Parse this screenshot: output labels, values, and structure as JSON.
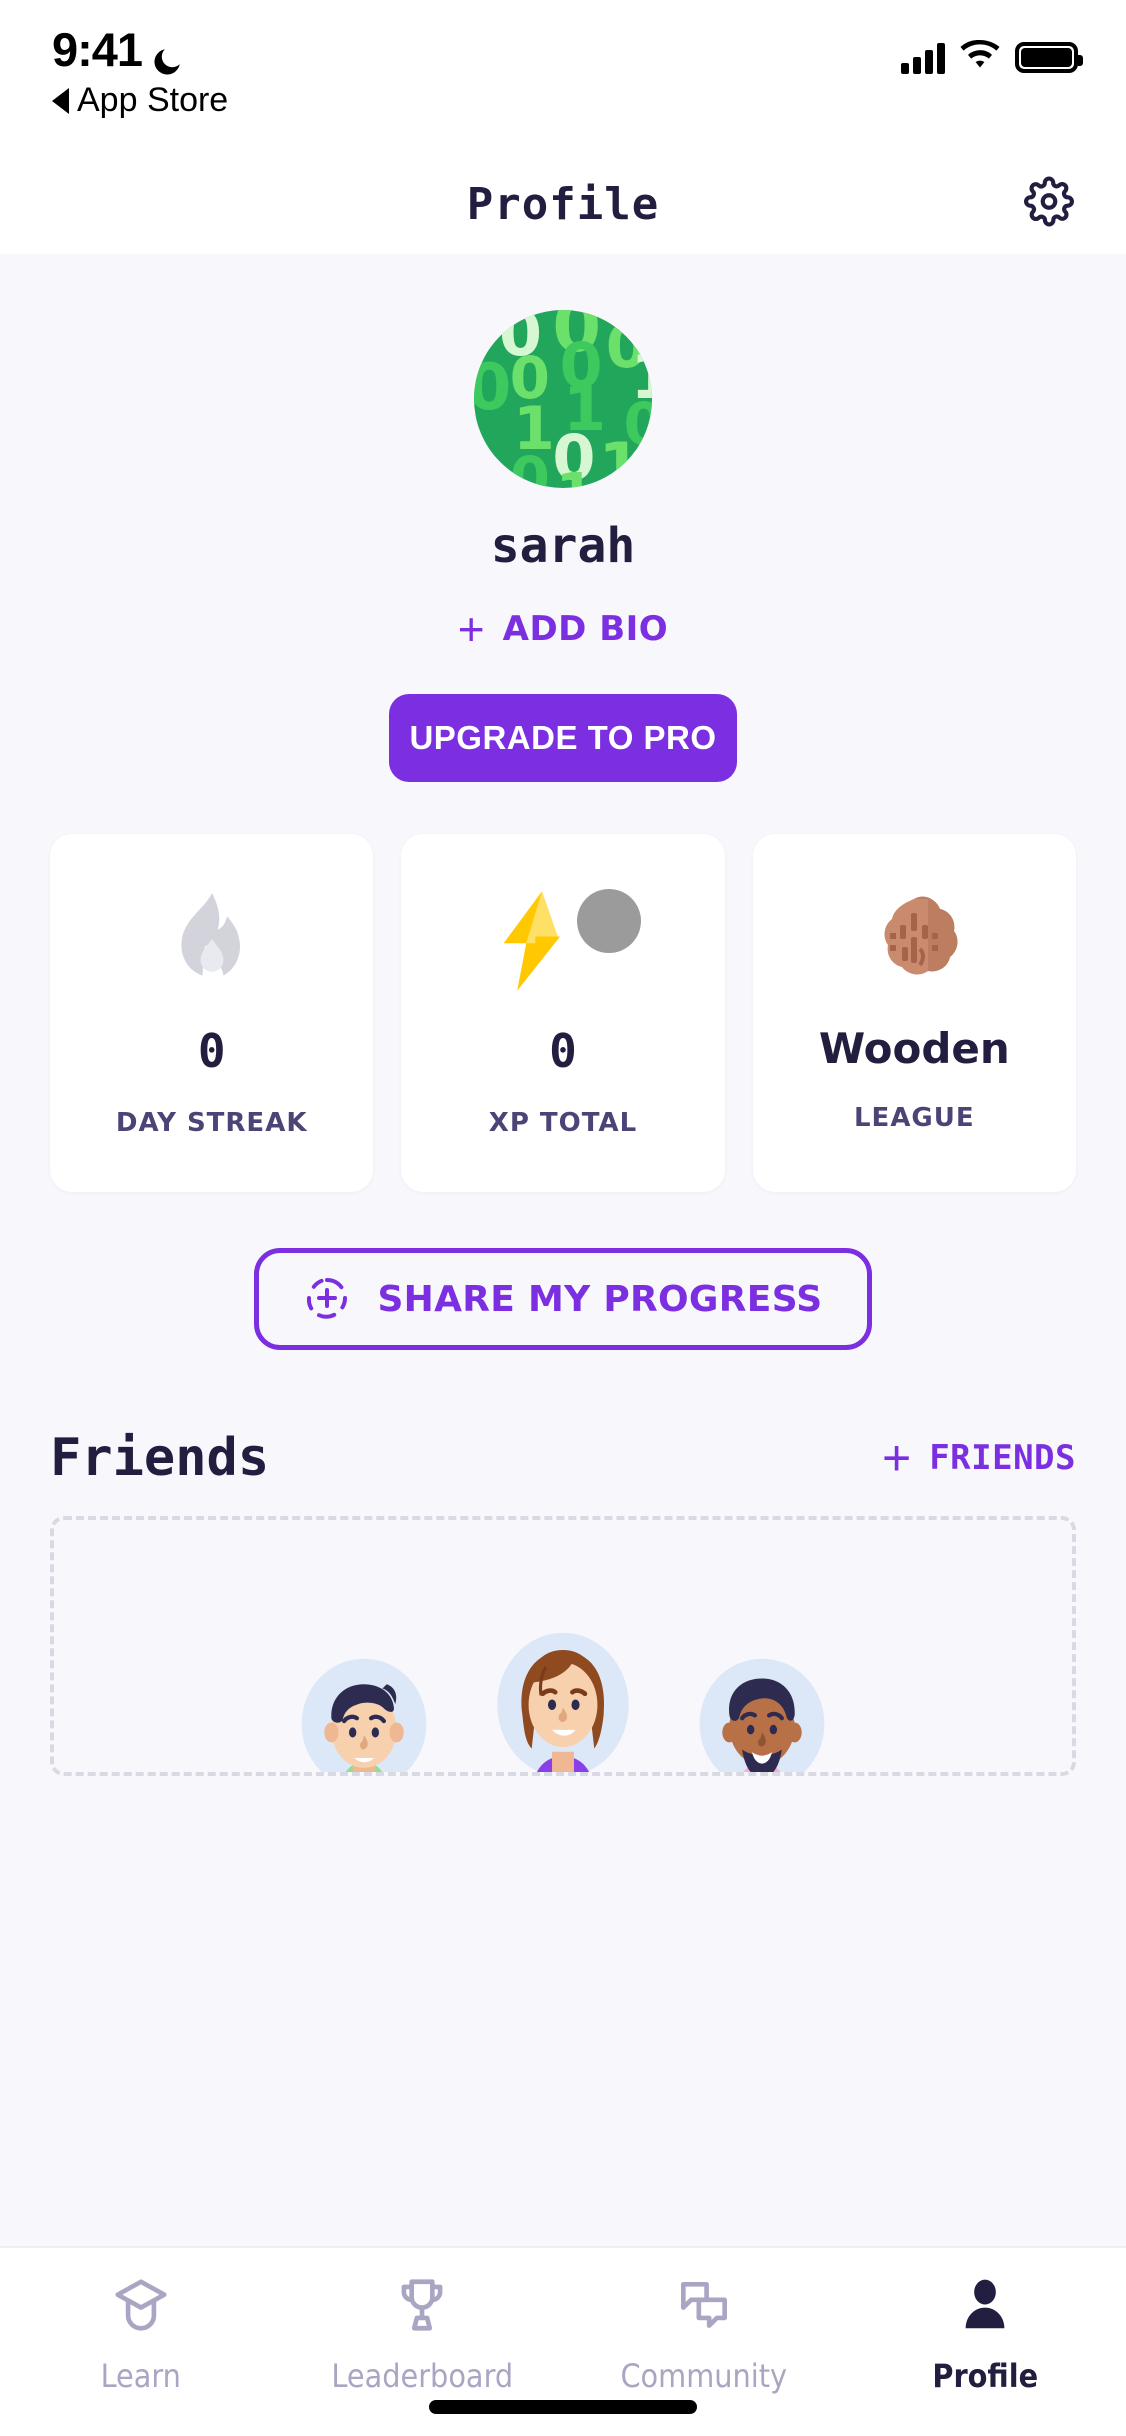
{
  "status_bar": {
    "time": "9:41",
    "moon_icon": "moon-icon",
    "back_label": "App Store",
    "signal_icon": "cellular-signal-icon",
    "wifi_icon": "wifi-icon",
    "battery_icon": "battery-full-icon"
  },
  "header": {
    "title": "Profile",
    "settings_icon": "gear-icon"
  },
  "profile": {
    "avatar_alt": "binary-code-avatar",
    "avatar_bg_color": "#22A65B",
    "username": "sarah",
    "add_bio_label": "ADD BIO",
    "add_bio_plus": "+",
    "upgrade_label": "UPGRADE TO PRO",
    "accent_color": "#7B2FE0"
  },
  "stats": [
    {
      "icon": "flame-icon",
      "value": "0",
      "label": "DAY STREAK",
      "icon_color": "#D3D3DC"
    },
    {
      "icon": "lightning-bolt-icon",
      "value": "0",
      "label": "XP TOTAL",
      "icon_color": "#FFC800",
      "secondary_icon": "gray-circle-icon",
      "secondary_color": "#9B9B9B"
    },
    {
      "icon": "wooden-league-badge-icon",
      "value": "Wooden",
      "label": "LEAGUE",
      "icon_color": "#C98A6E"
    }
  ],
  "share": {
    "icon": "share-circle-plus-icon",
    "label": "SHARE MY PROGRESS"
  },
  "friends": {
    "title": "Friends",
    "add_plus": "+",
    "add_label": "FRIENDS",
    "avatars": [
      {
        "name": "friend-avatar-1",
        "alt": "man-with-dark-hair-avatar"
      },
      {
        "name": "friend-avatar-2",
        "alt": "woman-with-brown-hair-avatar"
      },
      {
        "name": "friend-avatar-3",
        "alt": "man-with-beard-avatar"
      }
    ]
  },
  "tabs": [
    {
      "label": "Learn",
      "icon": "graduation-cap-icon",
      "active": false
    },
    {
      "label": "Leaderboard",
      "icon": "trophy-icon",
      "active": false
    },
    {
      "label": "Community",
      "icon": "chat-bubbles-icon",
      "active": false
    },
    {
      "label": "Profile",
      "icon": "person-icon",
      "active": true
    }
  ]
}
